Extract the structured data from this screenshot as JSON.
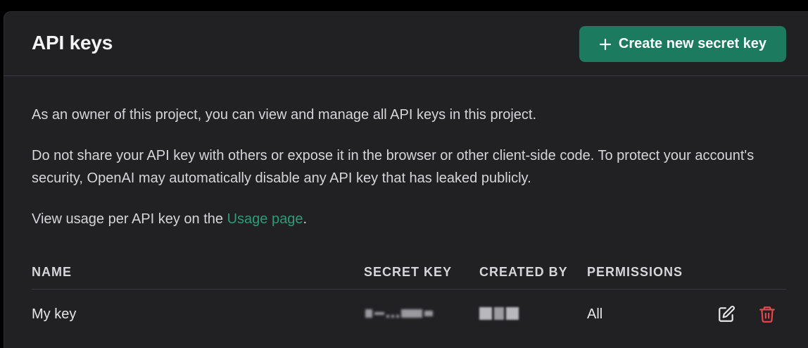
{
  "header": {
    "title": "API keys",
    "create_button_label": "Create new secret key"
  },
  "description": {
    "paragraph1": "As an owner of this project, you can view and manage all API keys in this project.",
    "paragraph2": "Do not share your API key with others or expose it in the browser or other client-side code. To protect your account's security, OpenAI may automatically disable any API key that has leaked publicly.",
    "paragraph3_prefix": "View usage per API key on the ",
    "usage_link_label": "Usage page",
    "paragraph3_suffix": "."
  },
  "table": {
    "columns": {
      "name": "NAME",
      "secret_key": "SECRET KEY",
      "created_by": "CREATED BY",
      "permissions": "PERMISSIONS"
    },
    "rows": [
      {
        "name": "My key",
        "permissions": "All"
      }
    ]
  },
  "icons": {
    "create": "plus-icon",
    "edit": "edit-icon",
    "delete": "trash-icon"
  },
  "colors": {
    "accent": "#1c7a5e",
    "link": "#2a9d76",
    "danger": "#e5484d",
    "background": "#212124"
  }
}
